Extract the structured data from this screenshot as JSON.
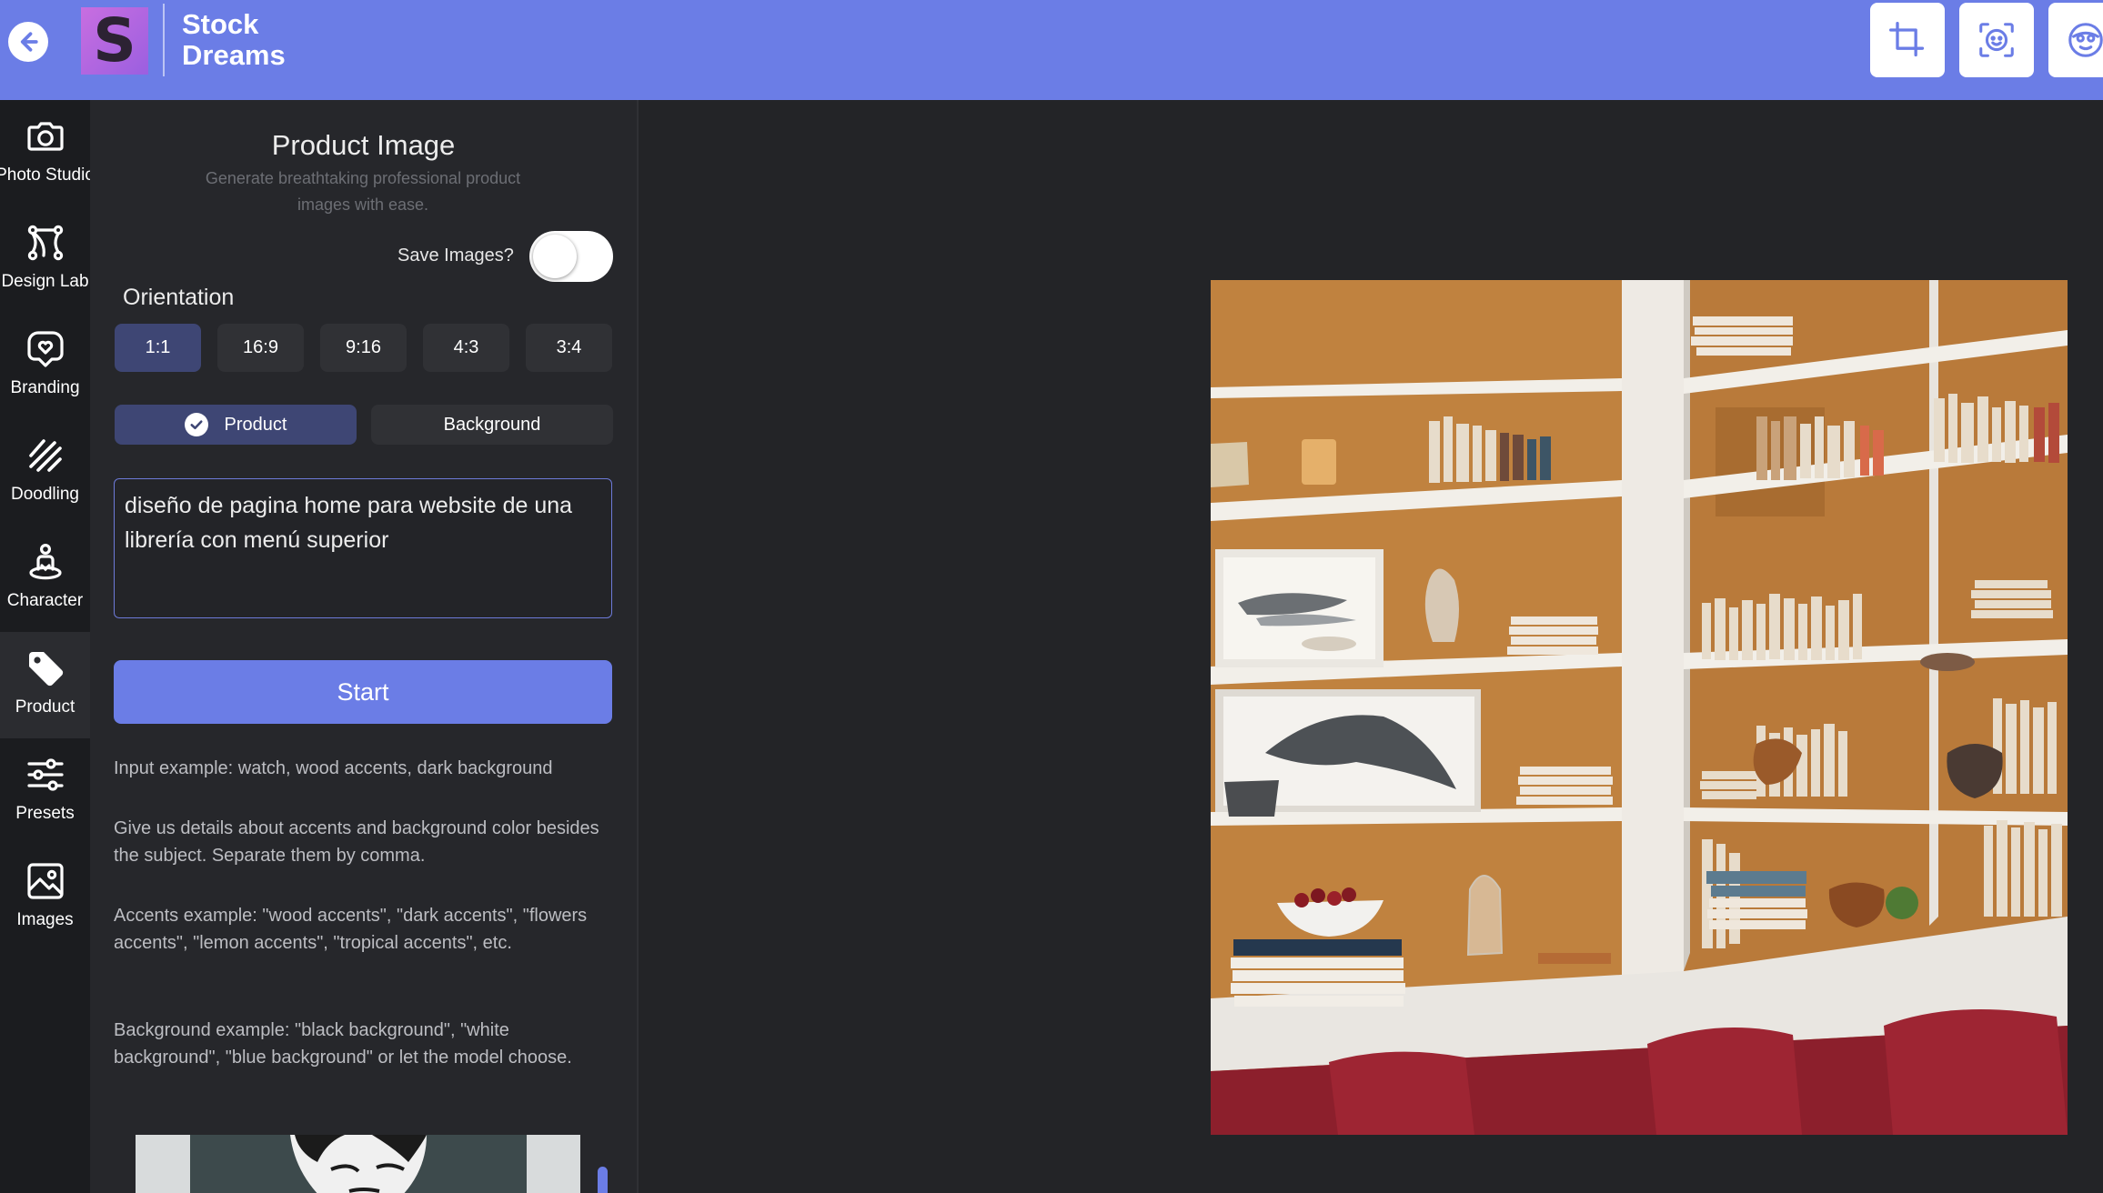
{
  "header": {
    "brand_line1": "Stock",
    "brand_line2": "Dreams",
    "logo_letter": "S",
    "back_icon": "arrow-left-icon",
    "tools": [
      "crop-icon",
      "face-scan-icon",
      "face-mask-icon"
    ]
  },
  "nav": {
    "items": [
      {
        "label": "Photo Studio",
        "icon": "camera-icon"
      },
      {
        "label": "Design Lab",
        "icon": "bezier-icon"
      },
      {
        "label": "Branding",
        "icon": "heart-badge-icon"
      },
      {
        "label": "Doodling",
        "icon": "scribble-icon"
      },
      {
        "label": "Character",
        "icon": "person-icon"
      },
      {
        "label": "Product",
        "icon": "tag-icon"
      },
      {
        "label": "Presets",
        "icon": "sliders-icon"
      },
      {
        "label": "Images",
        "icon": "image-icon"
      }
    ],
    "active": "Product"
  },
  "panel": {
    "title": "Product Image",
    "subtitle": "Generate breathtaking professional product images with ease.",
    "save_label": "Save Images?",
    "save_enabled": false,
    "orientation_label": "Orientation",
    "orientations": [
      "1:1",
      "16:9",
      "9:16",
      "4:3",
      "3:4"
    ],
    "orientation_selected": "1:1",
    "modes": [
      "Product",
      "Background"
    ],
    "mode_selected": "Product",
    "prompt": "diseño de pagina home para website de una librería con menú superior",
    "start_label": "Start",
    "help": [
      "Input example:  watch, wood accents, dark background",
      "Give us details about accents and background color besides the subject. Separate them by comma.",
      "Accents example: \"wood accents\", \"dark accents\", \"flowers accents\", \"lemon accents\", \"tropical accents\", etc.",
      "Background example:  \"black background\", \"white background\", \"blue background\" or let the model choose."
    ]
  },
  "colors": {
    "accent": "#6b7de6",
    "selected": "#3e4674",
    "panel": "#26272b",
    "nav": "#1b1c1f",
    "main": "#232427"
  }
}
